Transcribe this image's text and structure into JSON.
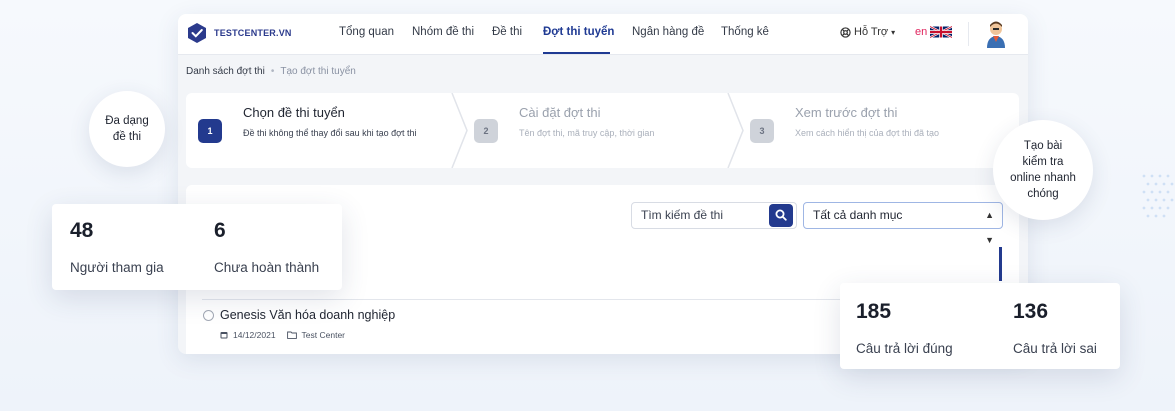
{
  "brand": {
    "name": "TESTCENTER.VN",
    "color": "#2b3a8c"
  },
  "nav": {
    "items": [
      {
        "label": "Tổng quan",
        "active": false
      },
      {
        "label": "Nhóm đề thi",
        "active": false
      },
      {
        "label": "Đề thi",
        "active": false
      },
      {
        "label": "Đợt thi tuyển",
        "active": true
      },
      {
        "label": "Ngân hàng đề",
        "active": false
      },
      {
        "label": "Thống kê",
        "active": false
      }
    ],
    "help_label": "Hỗ Trợ",
    "lang_label": "en"
  },
  "breadcrumb": {
    "current": "Danh sách đợt thi",
    "next": "Tạo đợt thi tuyển"
  },
  "steps": [
    {
      "num": "1",
      "title": "Chọn đề thi tuyển",
      "desc": "Đề thi không thể thay đổi sau khi tạo đợt thi",
      "active": true
    },
    {
      "num": "2",
      "title": "Cài đặt đợt thi",
      "desc": "Tên đợt thi, mã truy cập, thời gian",
      "active": false
    },
    {
      "num": "3",
      "title": "Xem trước đợt thi",
      "desc": "Xem cách hiển thị của đợt thi đã tạo",
      "active": false
    }
  ],
  "search": {
    "placeholder": "Tìm kiếm đề thi"
  },
  "category_select": {
    "value": "Tất cả danh mục"
  },
  "exam_item": {
    "title": "Genesis Văn hóa doanh nghiệp",
    "date": "14/12/2021",
    "folder": "Test Center"
  },
  "stats_left": [
    {
      "value": "48",
      "label": "Người tham gia"
    },
    {
      "value": "6",
      "label": "Chưa hoàn thành"
    }
  ],
  "stats_right": [
    {
      "value": "185",
      "label": "Câu trả lời đúng"
    },
    {
      "value": "136",
      "label": "Câu trả lời sai"
    }
  ],
  "bubbles": {
    "left": {
      "line1": "Đa dạng",
      "line2": "đề thi"
    },
    "right": {
      "line1": "Tạo bài",
      "line2": "kiểm tra",
      "line3": "online nhanh",
      "line4": "chóng"
    }
  },
  "accent_color": "#233a8e"
}
